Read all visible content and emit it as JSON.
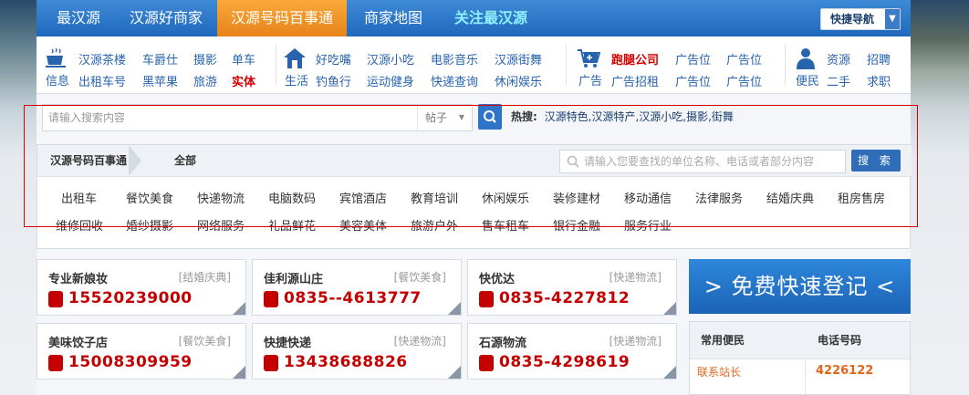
{
  "nav": {
    "tabs": [
      "最汉源",
      "汉源好商家",
      "汉源号码百事通",
      "商家地图",
      "关注最汉源"
    ],
    "quick_nav": "快捷导航"
  },
  "categories": {
    "info": {
      "label": "信息",
      "items": [
        "汉源茶楼",
        "车爵仕",
        "摄影",
        "单车",
        "出租车号",
        "黑苹果",
        "旅游",
        "实体"
      ]
    },
    "life": {
      "label": "生活",
      "items": [
        "好吃嘴",
        "汉源小吃",
        "电影音乐",
        "汉源街舞",
        "钓鱼行",
        "运动健身",
        "快递查询",
        "休闲娱乐"
      ]
    },
    "ads": {
      "label": "广告",
      "items": [
        "跑腿公司",
        "广告位",
        "广告位",
        "广告招租",
        "广告位",
        "广告位"
      ]
    },
    "conv": {
      "label": "便民",
      "items": [
        "资源",
        "招聘",
        "二手",
        "求职"
      ]
    }
  },
  "search": {
    "placeholder": "请输入搜索内容",
    "scope": "帖子",
    "hot_label": "热搜:",
    "hot_terms": "汉源特色,汉源特产,汉源小吃,摄影,街舞"
  },
  "directory": {
    "crumb_root": "汉源号码百事通",
    "crumb_current": "全部",
    "search_placeholder": "请输入您要查找的单位名称、电话或者部分内容",
    "search_button": "搜 索",
    "items": [
      "出租车",
      "餐饮美食",
      "快递物流",
      "电脑数码",
      "宾馆酒店",
      "教育培训",
      "休闲娱乐",
      "装修建材",
      "移动通信",
      "法律服务",
      "结婚庆典",
      "租房售房",
      "维修回收",
      "婚纱摄影",
      "网络服务",
      "礼品鲜花",
      "美容美体",
      "旅游户外",
      "售车租车",
      "银行金融",
      "服务行业"
    ]
  },
  "listings": [
    {
      "name": "专业新娘妆",
      "tag": "[结婚庆典]",
      "tel": "15520239000"
    },
    {
      "name": "佳利源山庄",
      "tag": "[餐饮美食]",
      "tel": "0835--4613777"
    },
    {
      "name": "快优达",
      "tag": "[快递物流]",
      "tel": "0835-4227812"
    },
    {
      "name": "美味饺子店",
      "tag": "[餐饮美食]",
      "tel": "15008309959"
    },
    {
      "name": "快捷快递",
      "tag": "[快递物流]",
      "tel": "13438688826"
    },
    {
      "name": "石源物流",
      "tag": "[快递物流]",
      "tel": "0835-4298619"
    }
  ],
  "register": {
    "label": "> 免费快速登记 <"
  },
  "common_phones": {
    "col1": "常用便民",
    "col2": "电话号码",
    "rows": [
      {
        "name": "联系站长",
        "tel": "4226122"
      }
    ]
  },
  "colors": {
    "accent": "#1f68bd",
    "active_tab": "#e6831a",
    "phone_red": "#c40000",
    "highlight_box": "#dd0000"
  }
}
